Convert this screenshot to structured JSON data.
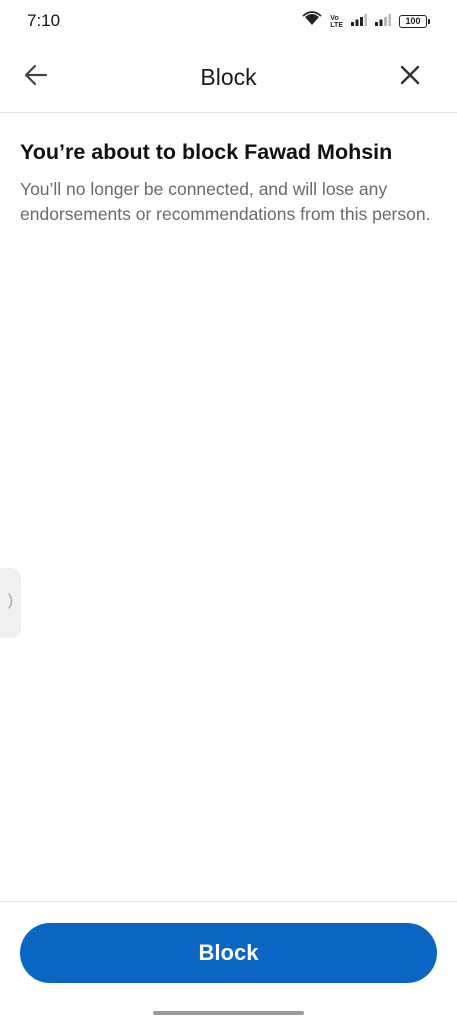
{
  "status_bar": {
    "time": "7:10",
    "volte_top": "Vo",
    "volte_bottom": "LTE",
    "battery": "100",
    "icons": [
      "wifi-icon",
      "volte-icon",
      "signal-icon",
      "signal-icon",
      "battery-icon"
    ]
  },
  "header": {
    "title": "Block",
    "back_icon": "arrow-left-icon",
    "close_icon": "close-icon"
  },
  "content": {
    "heading": "You’re about to block Fawad Mohsin",
    "body": "You’ll no longer be connected, and will lose any endorsements or recommendations from this person."
  },
  "footer": {
    "block_label": "Block"
  },
  "colors": {
    "accent": "#0a66c2",
    "text_primary": "#111111",
    "text_secondary": "#6a6a6a",
    "divider": "#e4e4e4"
  }
}
